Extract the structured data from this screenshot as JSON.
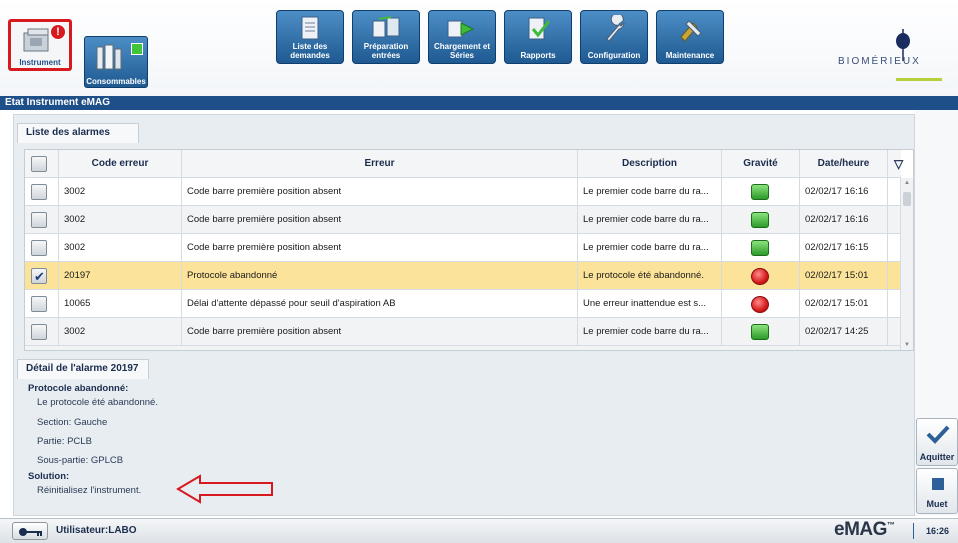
{
  "modules": [
    {
      "label": "Instrument",
      "alert": "!"
    },
    {
      "label": "Consommables"
    }
  ],
  "toolbar": [
    {
      "label": "Liste des\ndemandes",
      "icon": "list-document-icon"
    },
    {
      "label": "Préparation\nentrées",
      "icon": "preparation-icon"
    },
    {
      "label": "Chargement et\nSéries",
      "icon": "loading-arrow-icon"
    },
    {
      "label": "Rapports",
      "icon": "report-check-icon"
    },
    {
      "label": "Configuration",
      "icon": "wrench-icon"
    },
    {
      "label": "Maintenance",
      "icon": "tools-icon"
    }
  ],
  "logo": {
    "text": "BIOMÉRIEUX"
  },
  "title_bar": "Etat Instrument eMAG",
  "alarms": {
    "section_title": "Liste des alarmes",
    "columns": [
      "Code erreur",
      "Erreur",
      "Description",
      "Gravité",
      "Date/heure"
    ],
    "rows": [
      {
        "checked": false,
        "code": "3002",
        "error": "Code barre première position absent",
        "description": "Le premier code barre du ra...",
        "severity": "ok",
        "date": "02/02/17 16:16"
      },
      {
        "checked": false,
        "code": "3002",
        "error": "Code barre première position absent",
        "description": "Le premier code barre du ra...",
        "severity": "ok",
        "date": "02/02/17 16:16"
      },
      {
        "checked": false,
        "code": "3002",
        "error": "Code barre première position absent",
        "description": "Le premier code barre du ra...",
        "severity": "ok",
        "date": "02/02/17 16:15"
      },
      {
        "checked": true,
        "code": "20197",
        "error": "Protocole abandonné",
        "description": "Le protocole été abandonné.",
        "severity": "error",
        "date": "02/02/17 15:01"
      },
      {
        "checked": false,
        "code": "10065",
        "error": "Délai d'attente dépassé pour seuil d'aspiration AB",
        "description": "Une erreur inattendue est s...",
        "severity": "error",
        "date": "02/02/17 15:01"
      },
      {
        "checked": false,
        "code": "3002",
        "error": "Code barre première position absent",
        "description": "Le premier code barre du ra...",
        "severity": "ok",
        "date": "02/02/17 14:25"
      }
    ]
  },
  "detail": {
    "section_title": "Détail de l'alarme 20197",
    "title": "Protocole abandonné:",
    "description": "Le protocole été abandonné.",
    "section": "Section: Gauche",
    "part": "Partie: PCLB",
    "subpart": "Sous-partie: GPLCB",
    "solution_label": "Solution:",
    "solution": "Réinitialisez l'instrument."
  },
  "side_buttons": {
    "acknowledge": "Aquitter",
    "mute": "Muet"
  },
  "status": {
    "user": "Utilisateur:LABO",
    "product": "eMAG",
    "trademark": "™",
    "time": "16:26"
  },
  "colors": {
    "title_bar": "#1f4f88",
    "selected_row": "#fbe39a",
    "alert_red": "#d71920",
    "ok_green": "#2c9b2a"
  }
}
